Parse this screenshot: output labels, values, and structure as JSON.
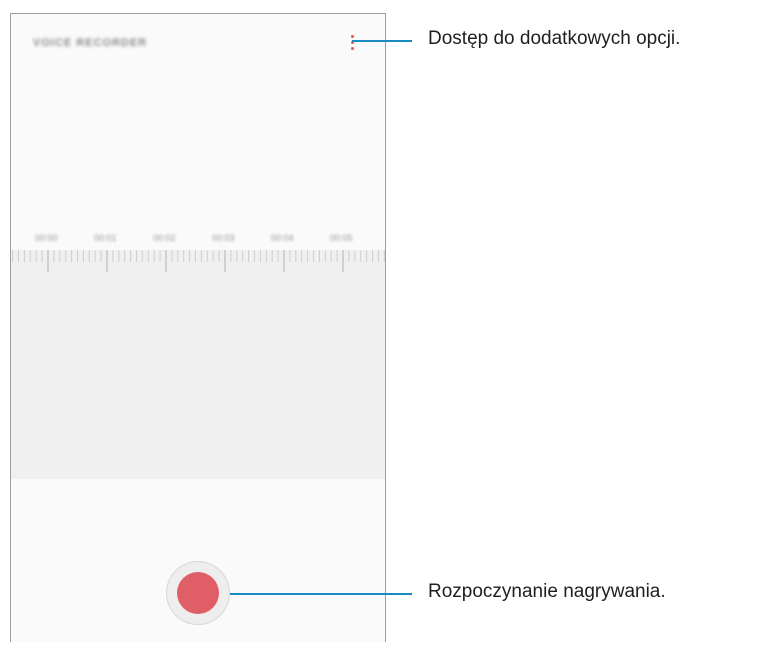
{
  "app": {
    "title": "VOICE RECORDER"
  },
  "timeline": {
    "ticks": [
      "00:00",
      "00:01",
      "00:02",
      "00:03",
      "00:04",
      "00:05"
    ]
  },
  "callouts": {
    "more_options": "Dostęp do dodatkowych opcji.",
    "record": "Rozpoczynanie nagrywania."
  },
  "icons": {
    "more": "more-vertical-icon",
    "record": "record-icon"
  },
  "colors": {
    "accent": "#e05a5a",
    "callout_line": "#1a8ac4",
    "record": "#e05f66"
  }
}
